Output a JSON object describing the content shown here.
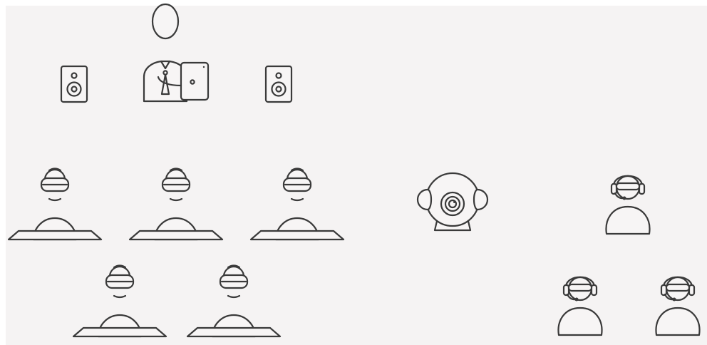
{
  "diagram": {
    "background_color": "#f5f3f3",
    "line_color": "#3a3a3a",
    "icons": {
      "presenter": "presenter-with-tablet-icon",
      "speaker": "speaker-icon",
      "vr_student": "student-with-vr-headset-icon",
      "camera_360": "360-camera-icon",
      "remote_user": "remote-user-with-headset-icon"
    },
    "groups": {
      "classroom_vr_students": 5,
      "remote_participants": 3,
      "speakers": 2
    }
  }
}
